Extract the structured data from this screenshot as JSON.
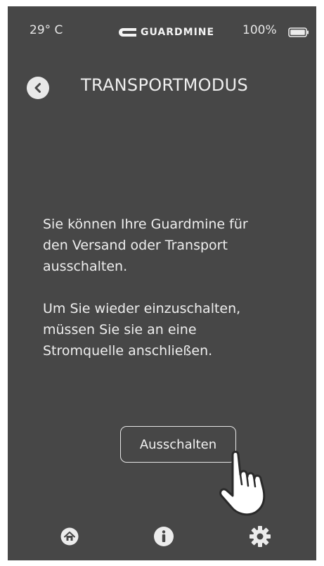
{
  "status_bar": {
    "temperature": "29° C",
    "brand": "GUARDMINE",
    "battery_level": "100%",
    "battery_fill": 1.0
  },
  "header": {
    "title": "TRANSPORTMODUS",
    "back_icon": "chevron-left-icon"
  },
  "content": {
    "paragraph_1": "Sie können Ihre Guardmine für\nden Versand oder Transport\nausschalten.",
    "paragraph_2": "Um Sie wieder einzuschalten,\nmüssen Sie sie an eine\nStromquelle anschließen."
  },
  "action": {
    "button_label": "Ausschalten",
    "pointer_icon": "hand-pointer-icon"
  },
  "tab_bar": {
    "items": [
      {
        "icon": "home-icon"
      },
      {
        "icon": "info-icon"
      },
      {
        "icon": "gear-icon"
      }
    ]
  },
  "colors": {
    "background": "#474747",
    "foreground": "#ececec"
  }
}
